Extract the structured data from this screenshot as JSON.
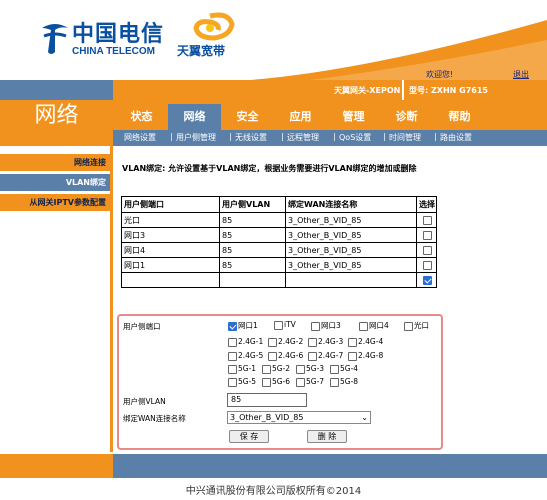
{
  "header": {
    "brand_cn": "中国电信",
    "brand_en": "CHINA TELECOM",
    "broadband_brand": "天翼宽带",
    "welcome": "欢迎您!",
    "logout": "退出",
    "device_name": "天翼网关-XEPON",
    "model": "型号: ZXHN G7615"
  },
  "section_title": "网络",
  "nav": {
    "tabs": [
      "状态",
      "网络",
      "安全",
      "应用",
      "管理",
      "诊断",
      "帮助"
    ],
    "active": "网络"
  },
  "subnav": [
    "网络设置",
    "用户侧管理",
    "无线设置",
    "远程管理",
    "QoS设置",
    "时间管理",
    "路由设置"
  ],
  "sidebar": {
    "items": [
      "网络连接",
      "VLAN绑定",
      "从网关IPTV参数配置"
    ],
    "active": "VLAN绑定"
  },
  "main": {
    "description": "VLAN绑定: 允许设置基于VLAN绑定，根据业务需要进行VLAN绑定的增加或删除",
    "table": {
      "headers": [
        "用户侧端口",
        "用户侧VLAN",
        "绑定WAN连接名称",
        "选择"
      ],
      "rows": [
        [
          "光口",
          "85",
          "3_Other_B_VID_85",
          false
        ],
        [
          "网口3",
          "85",
          "3_Other_B_VID_85",
          false
        ],
        [
          "网口4",
          "85",
          "3_Other_B_VID_85",
          false
        ],
        [
          "网口1",
          "85",
          "3_Other_B_VID_85",
          false
        ],
        [
          "",
          "",
          "",
          true
        ]
      ]
    },
    "form": {
      "port_label": "用户侧端口",
      "ports_row1": [
        {
          "label": "网口1",
          "checked": true
        },
        {
          "label": "iTV",
          "checked": false
        },
        {
          "label": "网口3",
          "checked": false
        },
        {
          "label": "网口4",
          "checked": false
        },
        {
          "label": "光口",
          "checked": false
        }
      ],
      "ports_24g_a": [
        "2.4G-1",
        "2.4G-2",
        "2.4G-3",
        "2.4G-4"
      ],
      "ports_24g_b": [
        "2.4G-5",
        "2.4G-6",
        "2.4G-7",
        "2.4G-8"
      ],
      "ports_5g_a": [
        "5G-1",
        "5G-2",
        "5G-3",
        "5G-4"
      ],
      "ports_5g_b": [
        "5G-5",
        "5G-6",
        "5G-7",
        "5G-8"
      ],
      "vlan_label": "用户侧VLAN",
      "vlan_value": "85",
      "wan_label": "绑定WAN连接名称",
      "wan_selected": "3_Other_B_VID_85",
      "save_label": "保 存",
      "delete_label": "删 除"
    }
  },
  "footer": {
    "copyright": "中兴通讯股份有限公司版权所有©2014"
  },
  "colors": {
    "brand_orange": "#f0921d",
    "nav_blue": "#5a7fa8",
    "telecom_blue": "#0a50a0",
    "form_border": "#e88a8a"
  }
}
